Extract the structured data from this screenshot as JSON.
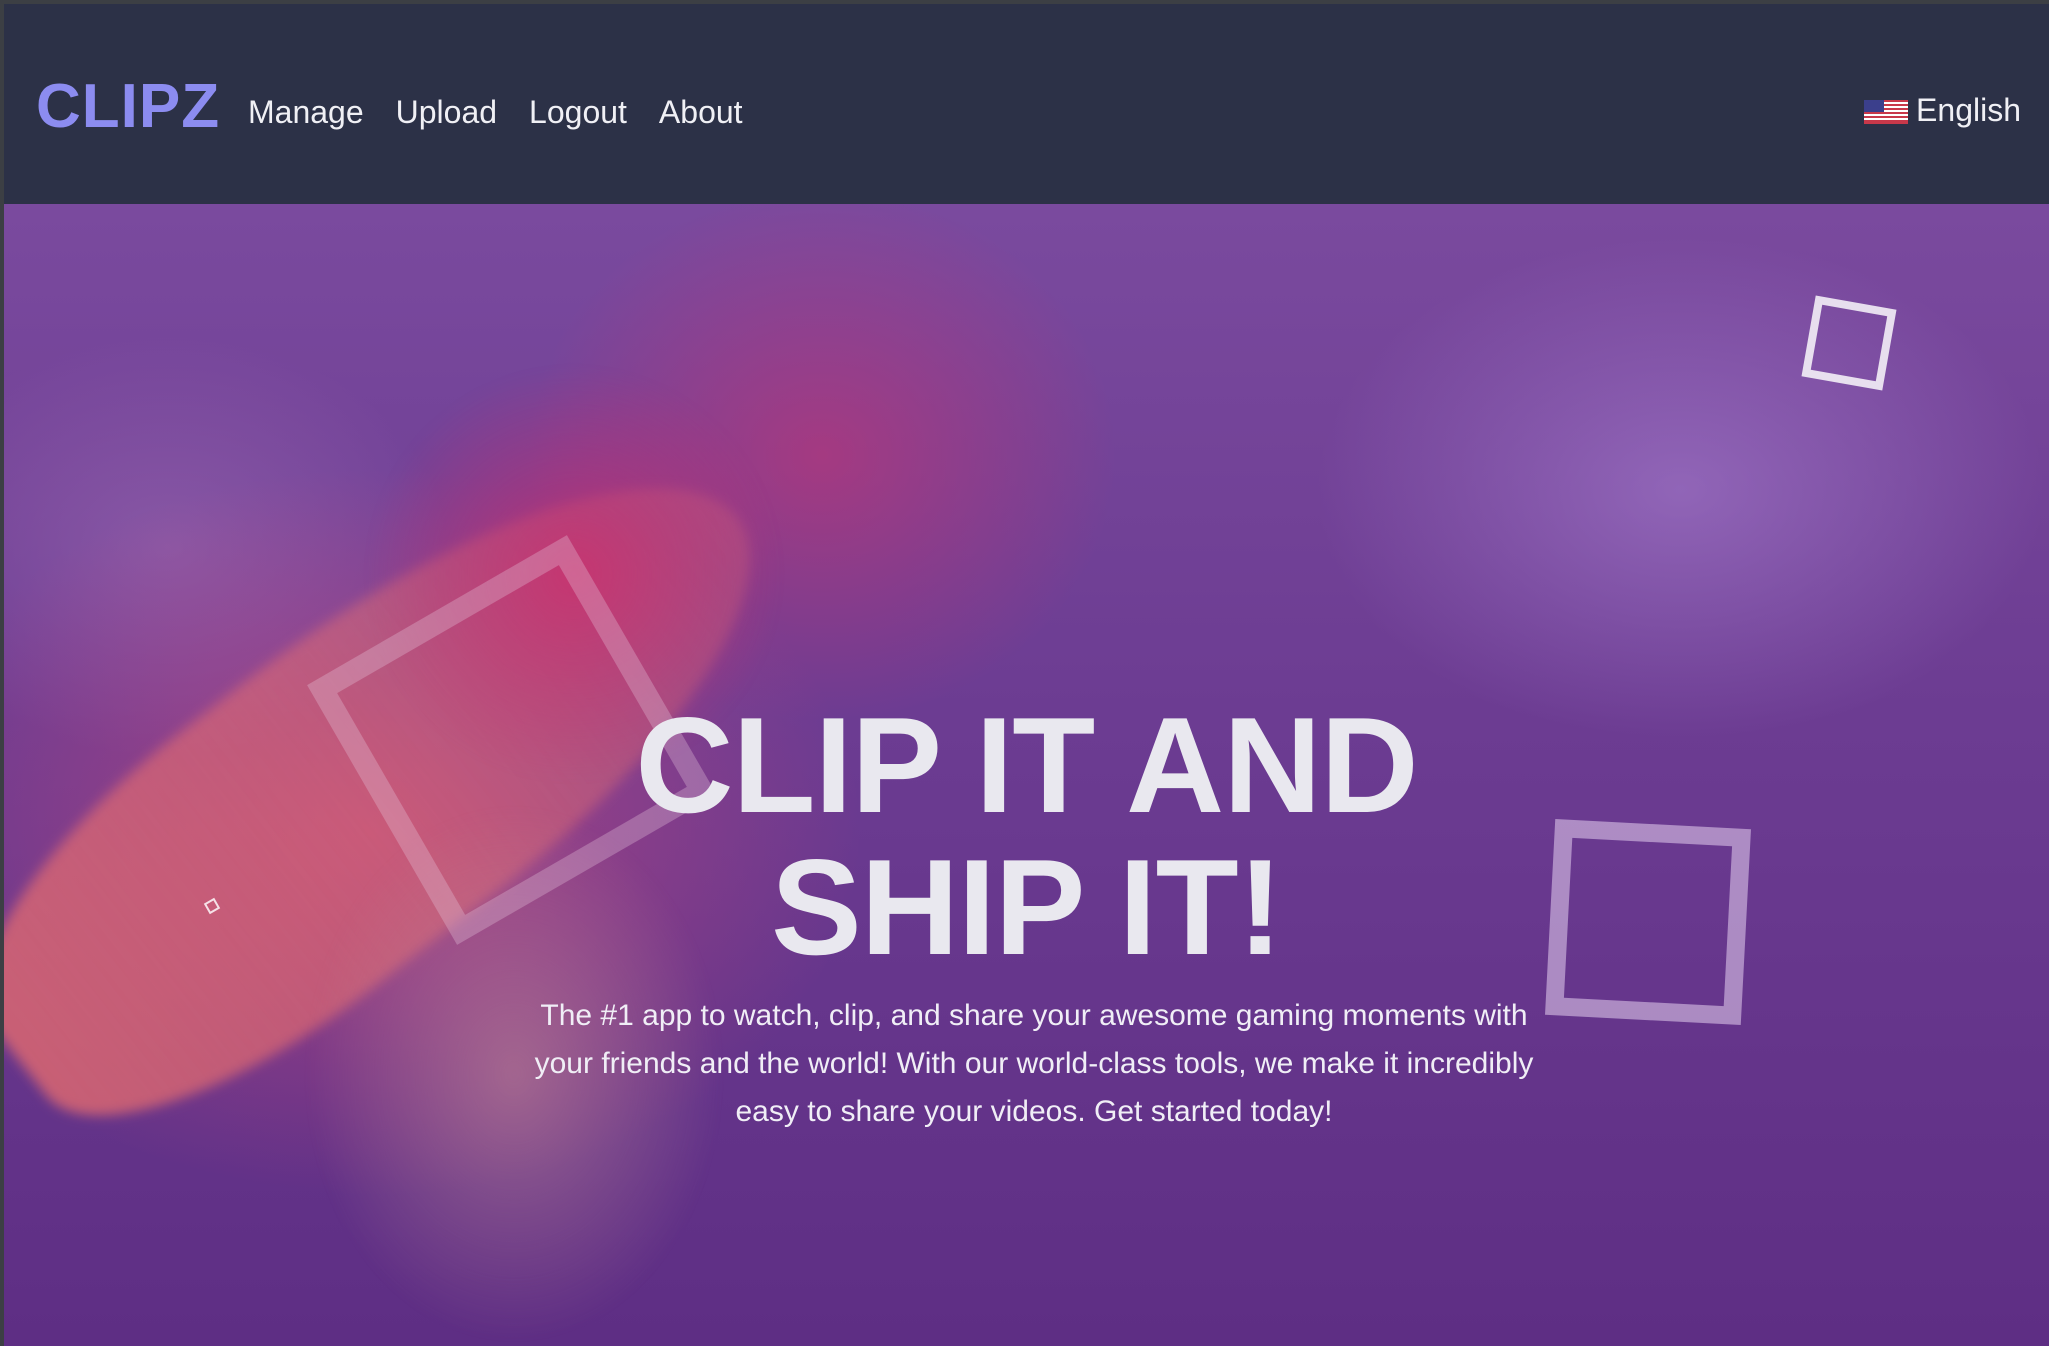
{
  "header": {
    "logo": "CLIPZ",
    "nav": [
      "Manage",
      "Upload",
      "Logout",
      "About"
    ],
    "language": {
      "label": "English",
      "flag_icon": "us-flag-icon"
    }
  },
  "hero": {
    "headline_line1": "CLIP IT AND",
    "headline_line2": "SHIP IT!",
    "tagline": "The #1 app to watch, clip, and share your awesome gaming moments with your friends and the world! With our world-class tools, we make it incredibly easy to share your videos. Get started today!"
  },
  "colors": {
    "header_bg": "#2c3147",
    "logo": "#8c8cf0",
    "hero_overlay": "#6c3c92",
    "text": "#e9e8ef"
  }
}
